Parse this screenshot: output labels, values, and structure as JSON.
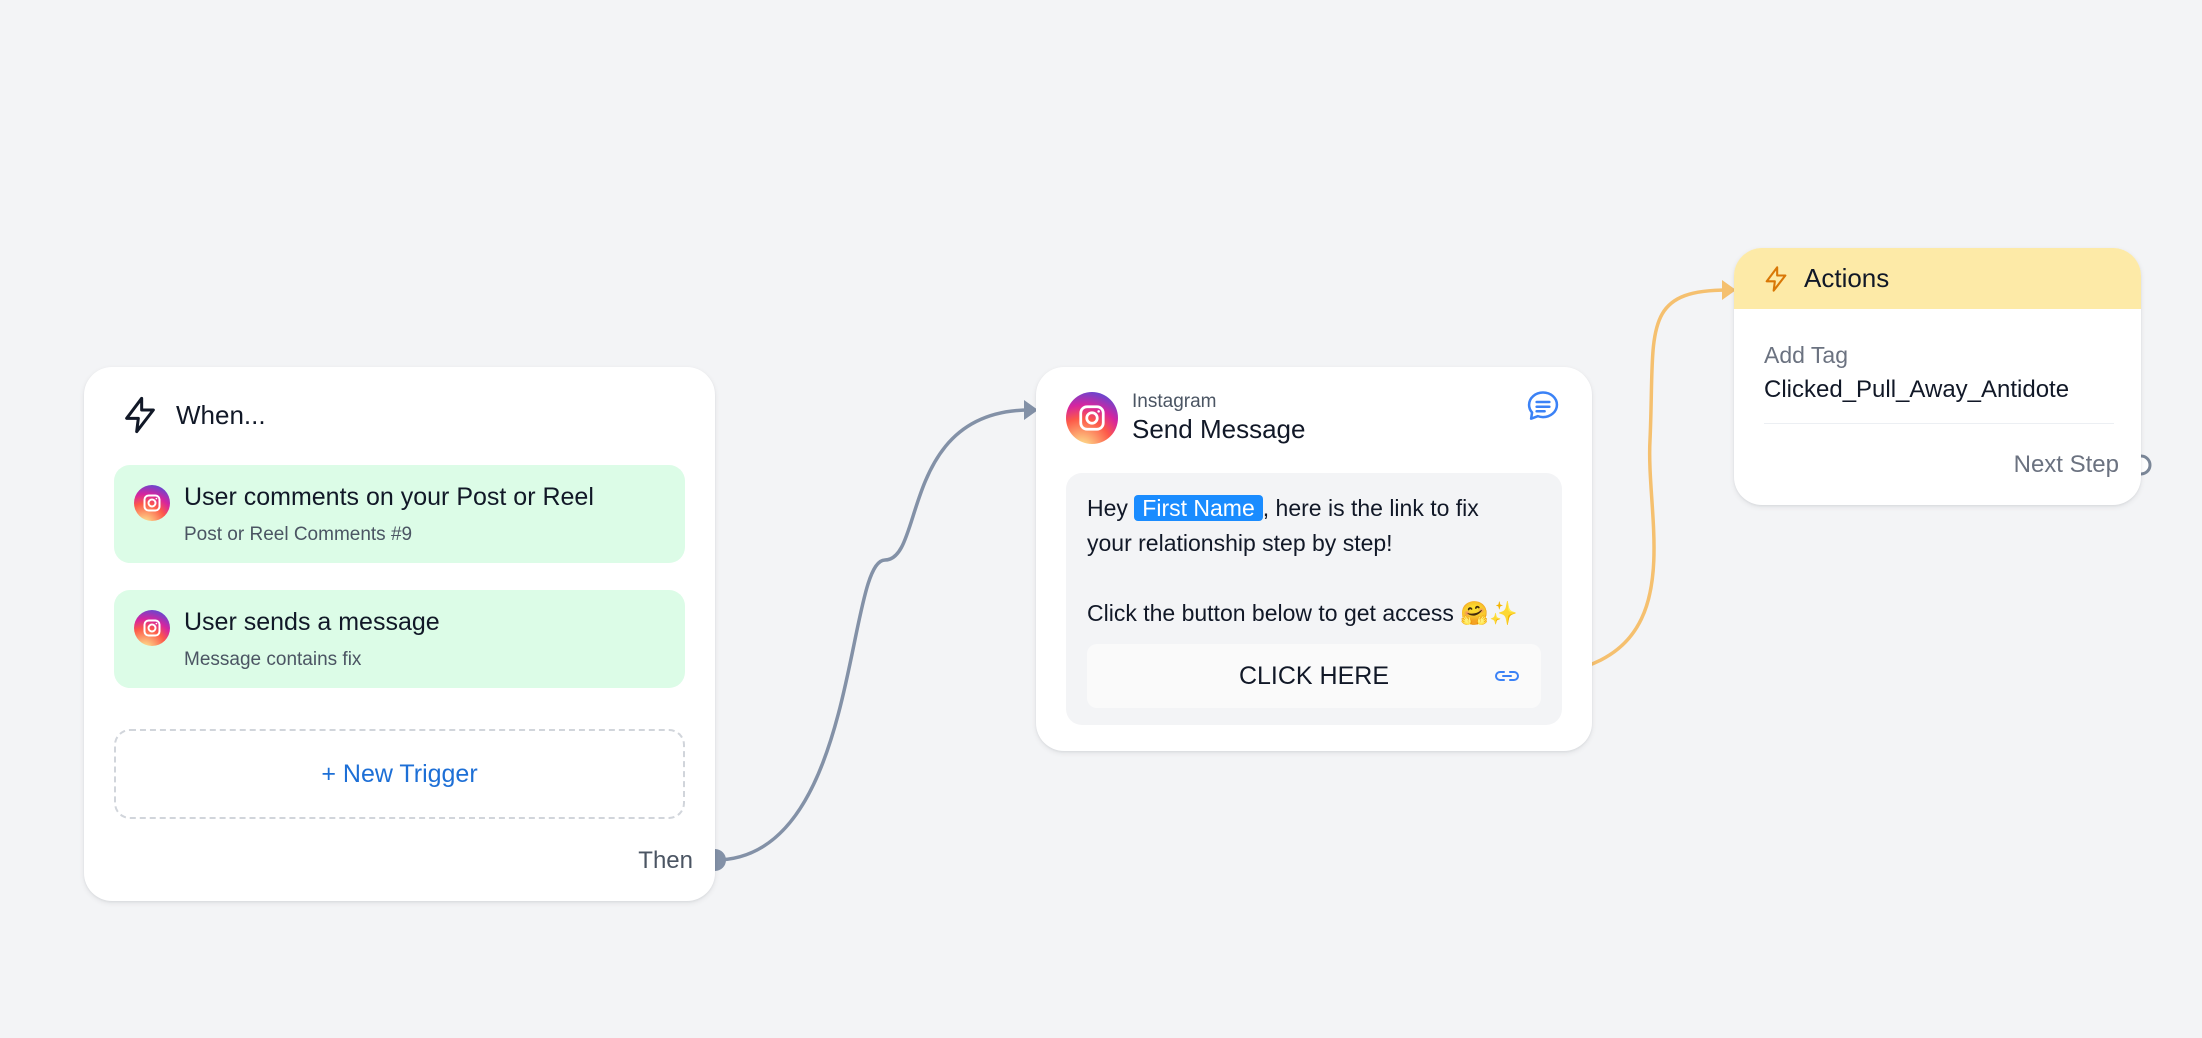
{
  "trigger_card": {
    "title": "When...",
    "triggers": [
      {
        "primary": "User comments on your Post or Reel",
        "secondary": "Post or Reel Comments #9",
        "icon": "instagram-icon"
      },
      {
        "primary": "User sends a message",
        "secondary": "Message contains fix",
        "icon": "instagram-icon"
      }
    ],
    "new_trigger_label": "+ New Trigger",
    "then_label": "Then",
    "icon": "lightning-icon"
  },
  "message_card": {
    "platform": "Instagram",
    "title": "Send Message",
    "text_prefix": "Hey ",
    "variable": "First Name",
    "text_line1_rest": ", here is the link to fix",
    "text_line2": "your relationship step by step!",
    "text_line3": "Click the button below to get access 🤗✨",
    "button_label": "CLICK HERE",
    "icons": [
      "instagram-icon",
      "chat-icon",
      "link-icon"
    ]
  },
  "actions_card": {
    "title": "Actions",
    "action_label": "Add Tag",
    "action_value": "Clicked_Pull_Away_Antidote",
    "next_step_label": "Next Step",
    "icon": "lightning-icon"
  },
  "colors": {
    "canvas_bg": "#f3f4f6",
    "trigger_bg": "#dcfce7",
    "actions_header_bg": "#fdeaa7",
    "edge_gray": "#8391a7",
    "edge_orange": "#f5c06f",
    "variable_chip": "#1a8cff",
    "link_blue": "#1d6fd6"
  }
}
